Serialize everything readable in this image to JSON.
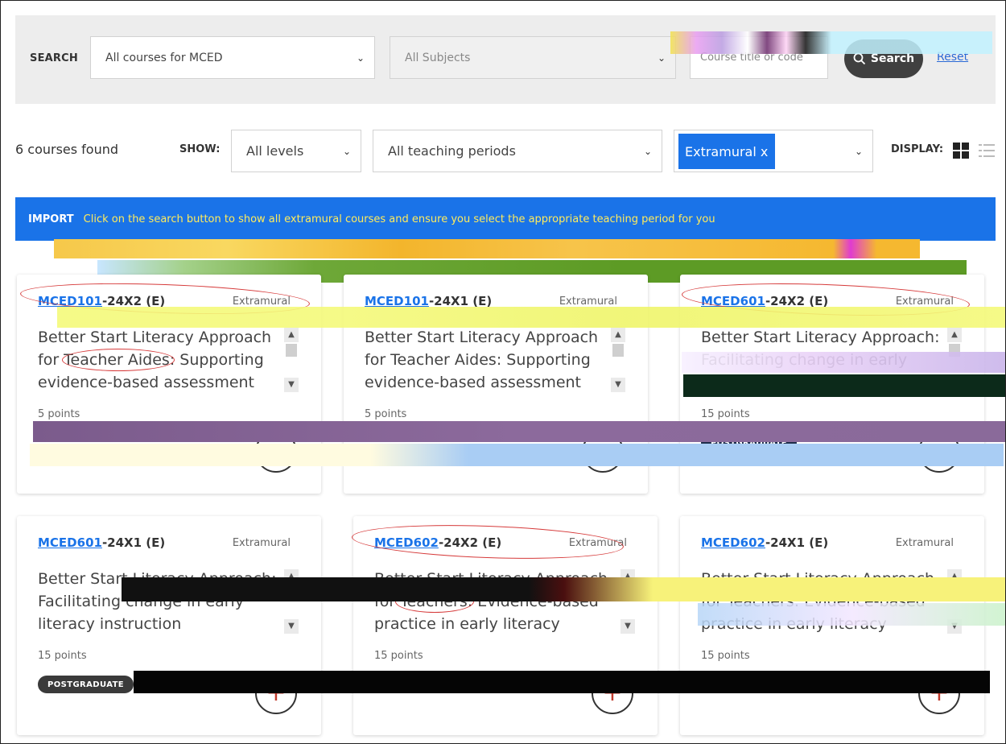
{
  "search": {
    "label": "SEARCH",
    "course_select": "All courses for MCED",
    "subject_select": "All Subjects",
    "input_placeholder": "Course title or code",
    "search_button": "Search",
    "reset_link": "Reset"
  },
  "filters": {
    "count_text": "6 courses found",
    "show_label": "SHOW:",
    "levels_select": "All levels",
    "periods_select": "All teaching periods",
    "mode_chip": "Extramural x",
    "display_label": "DISPLAY:"
  },
  "notice": {
    "label": "IMPORT",
    "message": "Click on the search button to show all extramural courses and ensure you select the appropriate teaching period for you"
  },
  "courses": [
    {
      "code_link": "MCED101",
      "code_rest": "-24X2 (E)",
      "mode": "Extramural",
      "title": "Better Start Literacy Approach for Teacher Aides: Supporting evidence-based assessment and",
      "points": "5 points",
      "badge": "",
      "add": "+"
    },
    {
      "code_link": "MCED101",
      "code_rest": "-24X1 (E)",
      "mode": "Extramural",
      "title": "Better Start Literacy Approach for Teacher Aides: Supporting evidence-based assessment and",
      "points": "5 points",
      "badge": "",
      "add": "+"
    },
    {
      "code_link": "MCED601",
      "code_rest": "-24X2 (E)",
      "mode": "Extramural",
      "title": "Better Start Literacy Approach: Facilitating change in early literacy instruction",
      "points": "15 points",
      "badge": "POSTGRADUATE",
      "add": "+"
    },
    {
      "code_link": "MCED601",
      "code_rest": "-24X1 (E)",
      "mode": "Extramural",
      "title": "Better Start Literacy Approach: Facilitating change in early literacy instruction",
      "points": "15 points",
      "badge": "POSTGRADUATE",
      "add": "+"
    },
    {
      "code_link": "MCED602",
      "code_rest": "-24X2 (E)",
      "mode": "Extramural",
      "title": "Better Start Literacy Approach for Teachers: Evidence-based practice in early literacy teaching",
      "points": "15 points",
      "badge": "",
      "add": "+"
    },
    {
      "code_link": "MCED602",
      "code_rest": "-24X1 (E)",
      "mode": "Extramural",
      "title": "Better Start Literacy Approach for Teachers: Evidence-based practice in early literacy teaching",
      "points": "15 points",
      "badge": "",
      "add": "+"
    }
  ]
}
